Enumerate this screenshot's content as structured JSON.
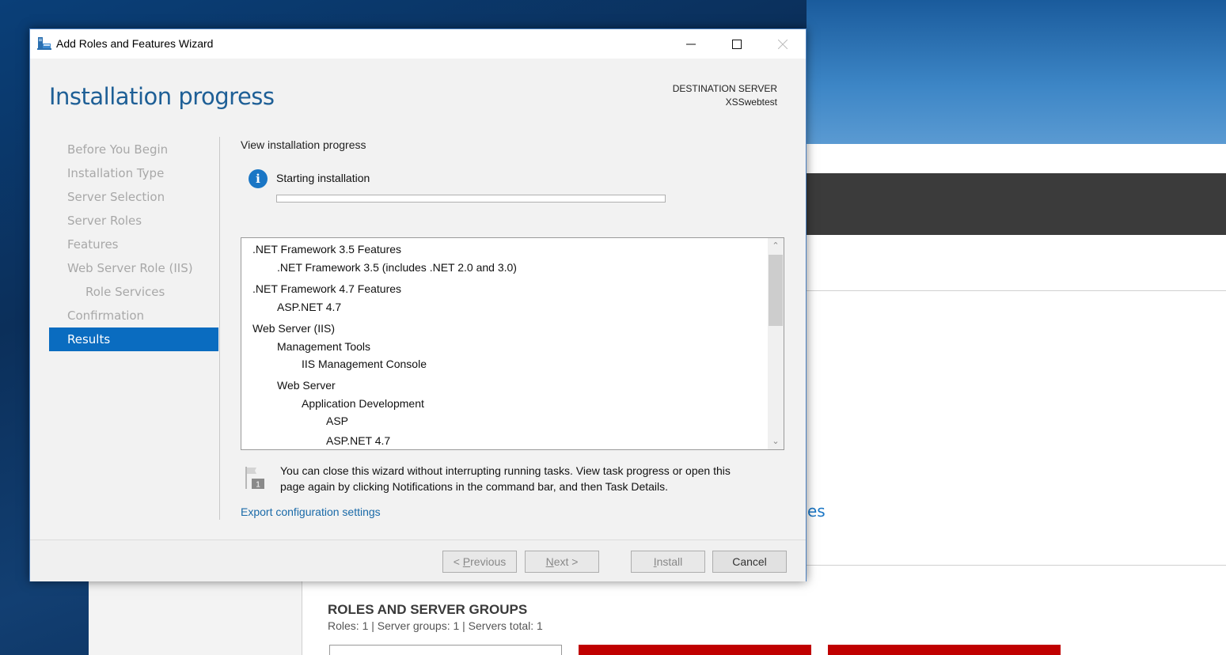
{
  "window": {
    "title": "Add Roles and Features Wizard",
    "minimize_icon": "minimize-icon",
    "maximize_icon": "maximize-icon",
    "close_icon": "close-icon"
  },
  "header": {
    "page_title": "Installation progress",
    "destination_label": "DESTINATION SERVER",
    "destination_server": "XSSwebtest"
  },
  "nav": {
    "items": [
      {
        "label": "Before You Begin",
        "state": "disabled"
      },
      {
        "label": "Installation Type",
        "state": "disabled"
      },
      {
        "label": "Server Selection",
        "state": "disabled"
      },
      {
        "label": "Server Roles",
        "state": "disabled"
      },
      {
        "label": "Features",
        "state": "disabled"
      },
      {
        "label": "Web Server Role (IIS)",
        "state": "disabled"
      },
      {
        "label": "Role Services",
        "state": "disabled",
        "sub": true
      },
      {
        "label": "Confirmation",
        "state": "disabled"
      },
      {
        "label": "Results",
        "state": "active"
      }
    ]
  },
  "main": {
    "section_title": "View installation progress",
    "status_text": "Starting installation",
    "progress_percent": 0,
    "features": [
      {
        "label": ".NET Framework 3.5 Features",
        "level": 0
      },
      {
        "label": ".NET Framework 3.5 (includes .NET 2.0 and 3.0)",
        "level": 1
      },
      {
        "label": ".NET Framework 4.7 Features",
        "level": 0
      },
      {
        "label": "ASP.NET 4.7",
        "level": 1
      },
      {
        "label": "Web Server (IIS)",
        "level": 0
      },
      {
        "label": "Management Tools",
        "level": 1
      },
      {
        "label": "IIS Management Console",
        "level": 2
      },
      {
        "label": "Web Server",
        "level": 1
      },
      {
        "label": "Application Development",
        "level": 2
      },
      {
        "label": "ASP",
        "level": 3
      },
      {
        "label": "ASP.NET 4.7",
        "level": 3
      }
    ],
    "flag_badge": "1",
    "note_line1": "You can close this wizard without interrupting running tasks. View task progress or open this",
    "note_line2": "page again by clicking Notifications in the command bar, and then Task Details.",
    "export_link": "Export configuration settings"
  },
  "footer": {
    "previous": {
      "prefix": "< ",
      "accel": "P",
      "rest": "revious"
    },
    "next": {
      "accel": "N",
      "rest": "ext >"
    },
    "install": {
      "accel": "I",
      "rest": "nstall"
    },
    "cancel": "Cancel"
  },
  "background": {
    "partial_text": "es",
    "roles_title": "ROLES AND SERVER GROUPS",
    "roles_summary": "Roles: 1   |   Server groups: 1   |   Servers total: 1",
    "accent_red": "#c00000"
  },
  "colors": {
    "accent_blue": "#0a6cc0",
    "title_blue": "#1e5f96",
    "link_blue": "#1a6aa8"
  }
}
